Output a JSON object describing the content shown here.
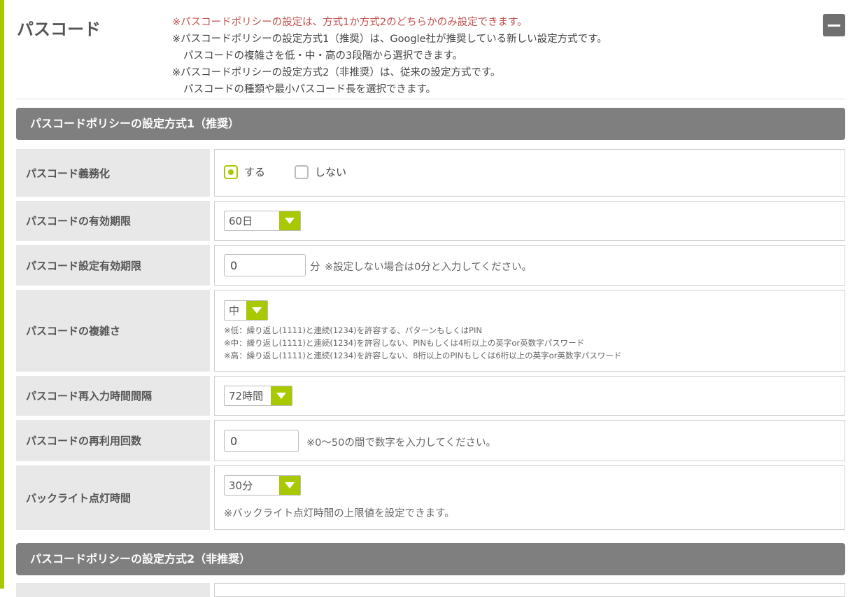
{
  "page": {
    "title": "パスコード",
    "collapse_icon": "minus-icon",
    "notes": [
      "※パスコードポリシーの設定は、方式1か方式2のどちらかのみ設定できます。",
      "※パスコードポリシーの設定方式1（推奨）は、Google社が推奨している新しい設定方式です。",
      "パスコードの複雑さを低・中・高の3段階から選択できます。",
      "※パスコードポリシーの設定方式2（非推奨）は、従来の設定方式です。",
      "パスコードの種類や最小パスコード長を選択できます。"
    ]
  },
  "colors": {
    "accent": "#a8c800",
    "header": "#7f7f7f",
    "note_red": "#c0504d"
  },
  "section1": {
    "title": "パスコードポリシーの設定方式1（推奨）",
    "rows": {
      "required": {
        "label": "パスコード義務化",
        "option_yes": "する",
        "option_no": "しない",
        "selected": "する"
      },
      "expiry": {
        "label": "パスコードの有効期限",
        "value": "60日"
      },
      "setting_expiry": {
        "label": "パスコード設定有効期限",
        "value": "0",
        "unit": "分",
        "hint": "※設定しない場合は0分と入力してください。"
      },
      "complexity": {
        "label": "パスコードの複雑さ",
        "value": "中",
        "notes": [
          "※低：繰り返し(1111)と連続(1234)を許容する、パターンもしくはPIN",
          "※中：繰り返し(1111)と連続(1234)を許容しない、PINもしくは4桁以上の英字or英数字パスワード",
          "※高：繰り返し(1111)と連続(1234)を許容しない、8桁以上のPINもしくは6桁以上の英字or英数字パスワード"
        ]
      },
      "reentry": {
        "label": "パスコード再入力時間間隔",
        "value": "72時間"
      },
      "reuse": {
        "label": "パスコードの再利用回数",
        "value": "0",
        "hint": "※0〜50の間で数字を入力してください。"
      },
      "backlight": {
        "label": "バックライト点灯時間",
        "value": "30分",
        "hint": "※バックライト点灯時間の上限値を設定できます。"
      }
    }
  },
  "section2": {
    "title": "パスコードポリシーの設定方式2（非推奨）"
  }
}
